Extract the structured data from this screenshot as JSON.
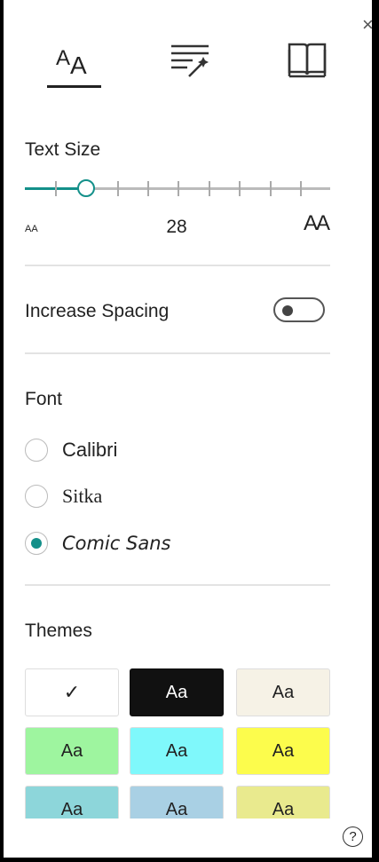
{
  "tabs": [
    {
      "icon": "text-size-icon",
      "selected": true
    },
    {
      "icon": "grammar-wand-icon",
      "selected": false
    },
    {
      "icon": "book-icon",
      "selected": false
    }
  ],
  "text_size": {
    "heading": "Text Size",
    "value": "28",
    "slider_level_fraction": 0.2,
    "small_glyph": "AA",
    "large_glyph": "AA"
  },
  "spacing": {
    "label": "Increase Spacing",
    "enabled": false
  },
  "font": {
    "heading": "Font",
    "options": [
      {
        "label": "Calibri",
        "selected": false
      },
      {
        "label": "Sitka",
        "selected": false
      },
      {
        "label": "Comic Sans",
        "selected": true
      }
    ]
  },
  "themes": {
    "heading": "Themes",
    "items": [
      {
        "label": "",
        "check": "✓",
        "bg": "#ffffff",
        "fg": "#222222",
        "selected": true
      },
      {
        "label": "Aa",
        "bg": "#111111",
        "fg": "#ffffff"
      },
      {
        "label": "Aa",
        "bg": "#f6f2e6",
        "fg": "#222222"
      },
      {
        "label": "Aa",
        "bg": "#9ef59f",
        "fg": "#222222"
      },
      {
        "label": "Aa",
        "bg": "#7ff8fb",
        "fg": "#222222"
      },
      {
        "label": "Aa",
        "bg": "#fcfc4c",
        "fg": "#222222"
      },
      {
        "label": "Aa",
        "bg": "#8dd6da",
        "fg": "#222222"
      },
      {
        "label": "Aa",
        "bg": "#a9d0e4",
        "fg": "#222222"
      },
      {
        "label": "Aa",
        "bg": "#e9ea8e",
        "fg": "#222222"
      }
    ]
  },
  "accent_color": "#14908a",
  "help_glyph": "?",
  "close_glyph": "×"
}
